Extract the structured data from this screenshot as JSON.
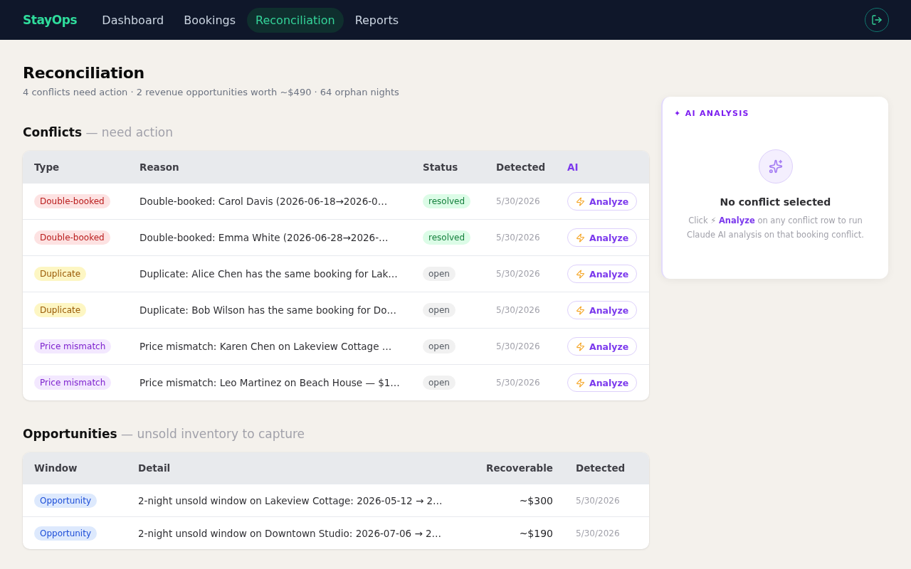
{
  "nav": {
    "brand": "StayOps",
    "items": [
      {
        "label": "Dashboard",
        "selected": false
      },
      {
        "label": "Bookings",
        "selected": false
      },
      {
        "label": "Reconciliation",
        "selected": true
      },
      {
        "label": "Reports",
        "selected": false
      }
    ]
  },
  "page": {
    "title": "Reconciliation",
    "subtitle": "4 conflicts need action · 2 revenue opportunities worth ~$490 · 64 orphan nights"
  },
  "conflicts": {
    "heading": "**Conflicts** — need action",
    "columns": [
      "Type",
      "Reason",
      "Status",
      "Detected",
      "AI"
    ],
    "rows": [
      {
        "type": {
          "label": "Double-booked",
          "kind": "double_booked"
        },
        "reason": "Double-booked: Carol Davis (2026-06-18→2026-0…",
        "status": {
          "label": "resolved",
          "kind": "resolved"
        },
        "detected": "5/30/2026",
        "action": "Analyze"
      },
      {
        "type": {
          "label": "Double-booked",
          "kind": "double_booked"
        },
        "reason": "Double-booked: Emma White (2026-06-28→2026-…",
        "status": {
          "label": "resolved",
          "kind": "resolved"
        },
        "detected": "5/30/2026",
        "action": "Analyze"
      },
      {
        "type": {
          "label": "Duplicate",
          "kind": "duplicate"
        },
        "reason": "Duplicate: Alice Chen has the same booking for Lak…",
        "status": {
          "label": "open",
          "kind": "open"
        },
        "detected": "5/30/2026",
        "action": "Analyze"
      },
      {
        "type": {
          "label": "Duplicate",
          "kind": "duplicate"
        },
        "reason": "Duplicate: Bob Wilson has the same booking for Do…",
        "status": {
          "label": "open",
          "kind": "open"
        },
        "detected": "5/30/2026",
        "action": "Analyze"
      },
      {
        "type": {
          "label": "Price mismatch",
          "kind": "price_mismatch"
        },
        "reason": "Price mismatch: Karen Chen on Lakeview Cottage …",
        "status": {
          "label": "open",
          "kind": "open"
        },
        "detected": "5/30/2026",
        "action": "Analyze"
      },
      {
        "type": {
          "label": "Price mismatch",
          "kind": "price_mismatch"
        },
        "reason": "Price mismatch: Leo Martinez on Beach House — $1…",
        "status": {
          "label": "open",
          "kind": "open"
        },
        "detected": "5/30/2026",
        "action": "Analyze"
      }
    ]
  },
  "opportunities": {
    "heading": "**Opportunities** — unsold inventory to capture",
    "columns": [
      "Window",
      "Detail",
      "Recoverable",
      "Detected"
    ],
    "rows": [
      {
        "window": {
          "label": "Opportunity",
          "kind": "opportunity"
        },
        "detail": "2-night unsold window on Lakeview Cottage: 2026-05-12 → 2…",
        "recoverable": "~$300",
        "detected": "5/30/2026"
      },
      {
        "window": {
          "label": "Opportunity",
          "kind": "opportunity"
        },
        "detail": "2-night unsold window on Downtown Studio: 2026-07-06 → 2…",
        "recoverable": "~$190",
        "detected": "5/30/2026"
      }
    ]
  },
  "ai_panel": {
    "label": "✦ AI ANALYSIS",
    "empty_title": "No conflict selected",
    "empty_hint": "Click ⚡ **Analyze** on any conflict row to run Claude AI analysis on that booking conflict."
  }
}
